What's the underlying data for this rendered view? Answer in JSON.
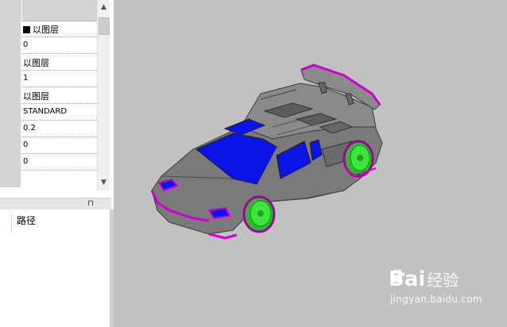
{
  "properties": {
    "rows": [
      {
        "value": "以图层",
        "swatch": true
      },
      {
        "value": "0"
      },
      {
        "value": "以图层"
      },
      {
        "value": "1"
      },
      {
        "value": "以图层"
      },
      {
        "value": "STANDARD"
      },
      {
        "value": "0.2"
      },
      {
        "value": "0"
      },
      {
        "value": "0"
      }
    ]
  },
  "dock": {
    "pin_glyph": "⊓"
  },
  "list_panel": {
    "column_header": "路径"
  },
  "watermark": {
    "brand": "Bai",
    "brand_suffix": "经验",
    "url": "jingyan.baidu.com"
  },
  "colors": {
    "viewport_bg": "#c1c1c1",
    "car_body": "#7a7a7a",
    "glass": "#0a14e6",
    "edges": "#d000d0",
    "wheels": "#3ce63c"
  }
}
